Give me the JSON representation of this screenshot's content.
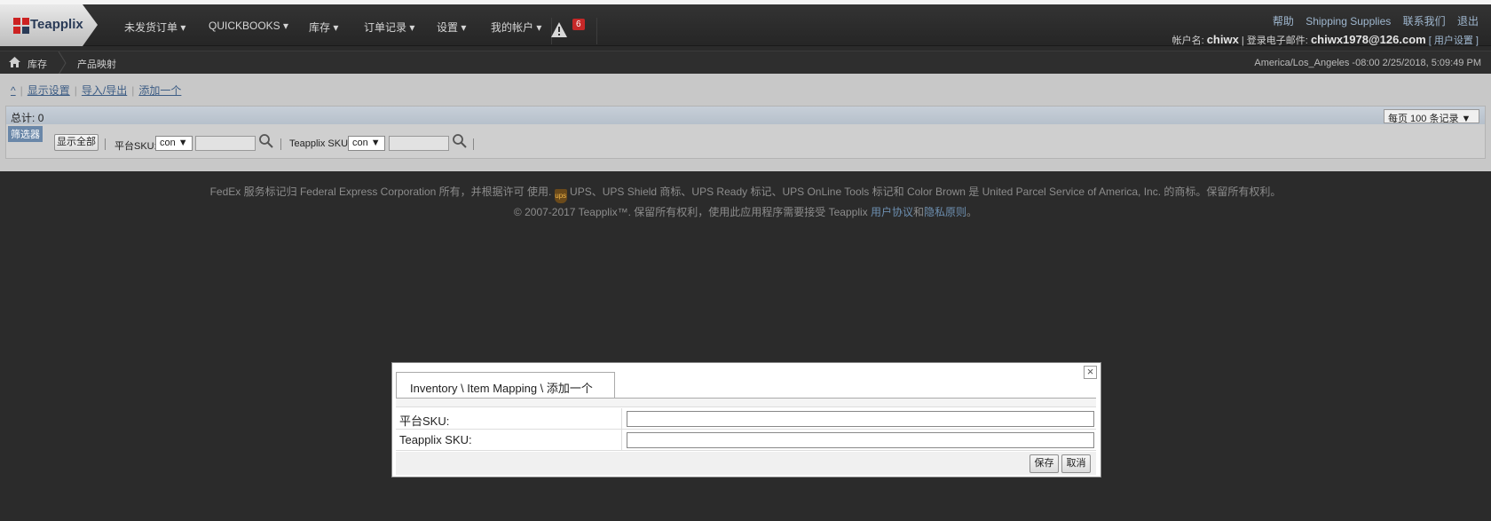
{
  "brand": {
    "name": "Teapplix"
  },
  "nav": {
    "items": [
      {
        "label": "未发货订单 ▾"
      },
      {
        "label": "QUICKBOOKS ▾"
      },
      {
        "label": "库存 ▾"
      },
      {
        "label": "订单记录 ▾"
      },
      {
        "label": "设置 ▾"
      },
      {
        "label": "我的帐户 ▾"
      }
    ],
    "alert_count": "6"
  },
  "toplinks": {
    "help": "帮助",
    "shipping": "Shipping Supplies",
    "contact": "联系我们",
    "logout": "退出"
  },
  "user": {
    "account_label": "帐户名:",
    "account": "chiwx",
    "email_label": "| 登录电子邮件:",
    "email": "chiwx1978@126.com",
    "settings": "[ 用户设置 ]"
  },
  "breadcrumb": {
    "section": "库存",
    "page": "产品映射"
  },
  "timezone": "America/Los_Angeles -08:00 2/25/2018, 5:09:49 PM",
  "toolbar": {
    "collapse": "^",
    "display_settings": "显示设置",
    "import_export": "导入/导出",
    "add_one": "添加一个"
  },
  "list": {
    "total_label": "总计:",
    "total": "0",
    "per_page": "每页 100 条记录 ▼",
    "filter_label": "筛选器",
    "show_all": "显示全部",
    "platform_sku_label": "平台SKU:",
    "platform_sku_op": "con ▼",
    "teapplix_sku_label": "Teapplix SKU:",
    "teapplix_sku_op": "con ▼"
  },
  "footer": {
    "line1_a": "FedEx 服务标记归 Federal Express Corporation 所有，并根据许可 使用.",
    "line1_b": "UPS、UPS Shield 商标、UPS Ready 标记、UPS OnLine Tools 标记和 Color Brown 是 United Parcel Service of America, Inc. 的商标。保留所有权利。",
    "line2_a": "© 2007-2017 Teapplix™. 保留所有权利，使用此应用程序需要接受 Teapplix ",
    "terms": "用户协议",
    "and": "和",
    "privacy": "隐私原则",
    "end": "。"
  },
  "modal": {
    "tab": "Inventory \\ Item Mapping \\ 添加一个",
    "close": "×",
    "fields": [
      {
        "label": "平台SKU:",
        "value": ""
      },
      {
        "label": "Teapplix SKU:",
        "value": ""
      }
    ],
    "save": "保存",
    "cancel": "取消"
  },
  "colors": {
    "accent": "#6a87a8",
    "brand": "#2a3b57",
    "alert": "#c62828"
  }
}
